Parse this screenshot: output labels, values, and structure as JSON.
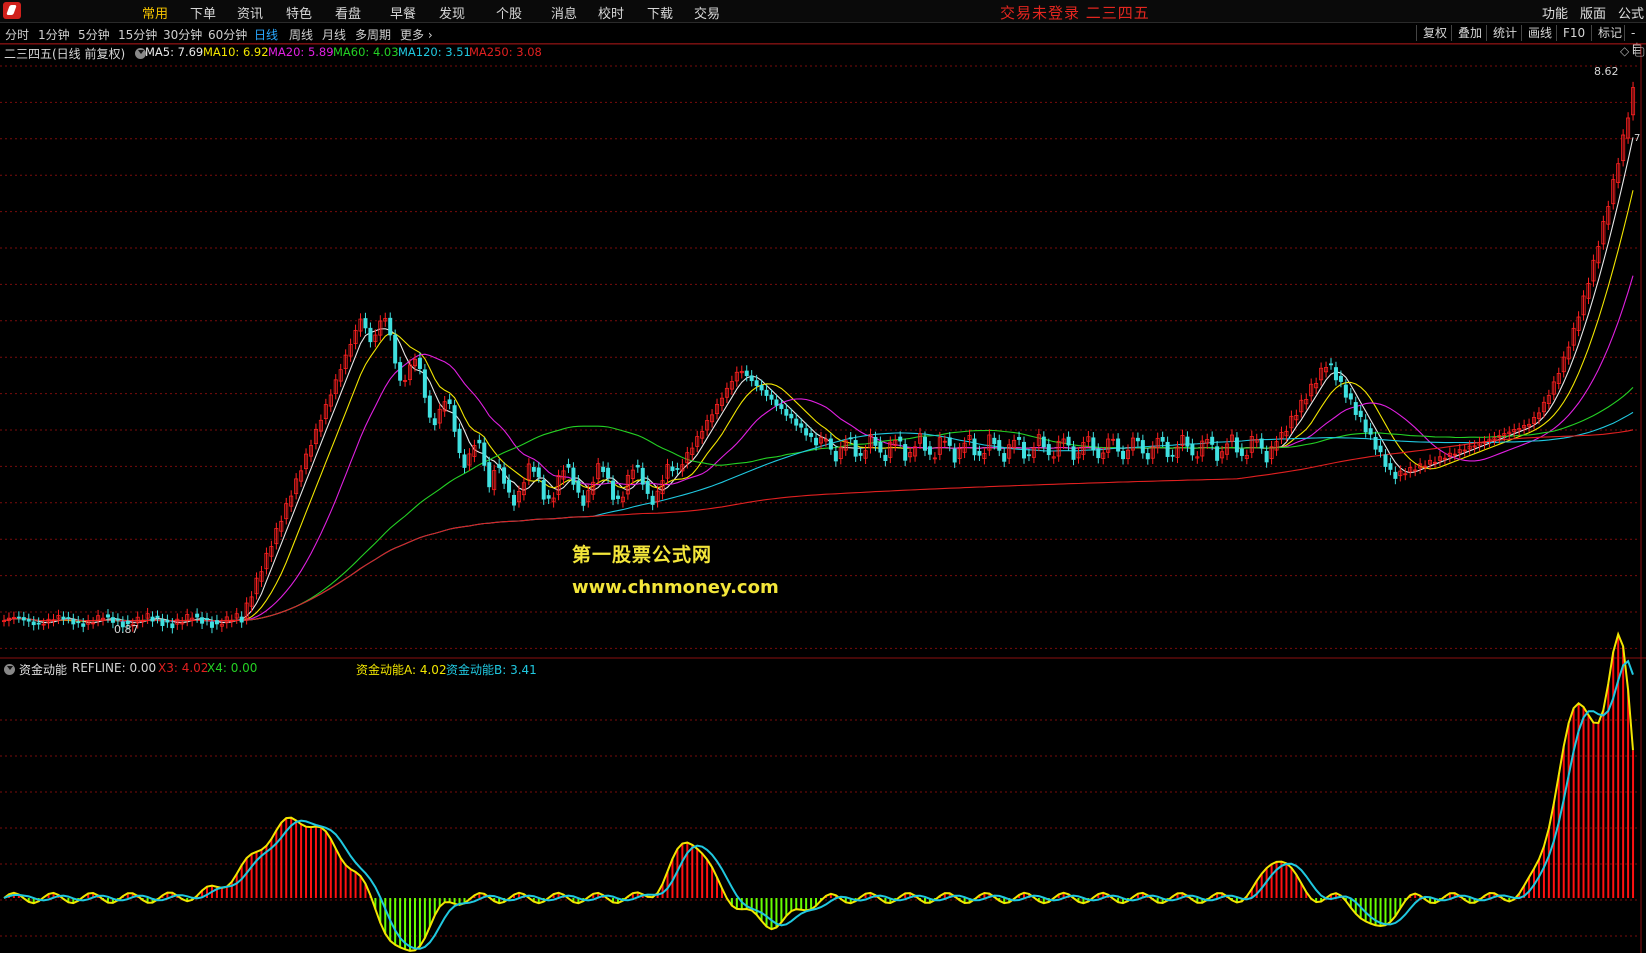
{
  "topbar": {
    "menus": [
      "常用",
      "下单",
      "资讯",
      "特色",
      "看盘",
      "早餐",
      "发现",
      "个股",
      "消息",
      "校时",
      "下载",
      "交易"
    ],
    "active_menu": "常用",
    "banner": "交易未登录    二三四五",
    "right_buttons": [
      "功能",
      "版面",
      "公式"
    ]
  },
  "timeframes": {
    "items": [
      "分时",
      "1分钟",
      "5分钟",
      "15分钟",
      "30分钟",
      "60分钟",
      "日线",
      "周线",
      "月线",
      "多周期",
      "更多"
    ],
    "active": "日线"
  },
  "tools": [
    "复权",
    "叠加",
    "统计",
    "画线",
    "F10",
    "标记",
    "-自"
  ],
  "main_panel": {
    "title": "二三四五(日线 前复权)",
    "ma_labels": [
      {
        "text": "MA5: 7.69",
        "color": "#e8e8e8"
      },
      {
        "text": "MA10: 6.92",
        "color": "#f2e600"
      },
      {
        "text": "MA20: 5.89",
        "color": "#e020e0"
      },
      {
        "text": "MA60: 4.03",
        "color": "#24d024"
      },
      {
        "text": "MA120: 3.51",
        "color": "#20c8e0"
      },
      {
        "text": "MA250: 3.08",
        "color": "#e02020"
      }
    ],
    "high_label": "8.62",
    "low_label": "0.87",
    "right_marker": "7"
  },
  "indicator_panel": {
    "name": "资金动能",
    "params": [
      {
        "text": "REFLINE: 0.00",
        "color": "#d6d6d6"
      },
      {
        "text": "X3: 4.02",
        "color": "#e02020"
      },
      {
        "text": "X4: 0.00",
        "color": "#24d024"
      },
      {
        "text": "资金动能A: 4.02",
        "color": "#f2e600"
      },
      {
        "text": "资金动能B: 3.41",
        "color": "#20c8e0"
      }
    ]
  },
  "watermark": {
    "line1": "第一股票公式网",
    "line2": "www.chnmoney.com"
  },
  "colors": {
    "up": "#ff2020",
    "down": "#40e0e0",
    "grid": "#7a0c0c",
    "hist_up": "#ff1010",
    "hist_down": "#66ff00",
    "line_a": "#f2e600",
    "line_b": "#20c8e0"
  }
}
